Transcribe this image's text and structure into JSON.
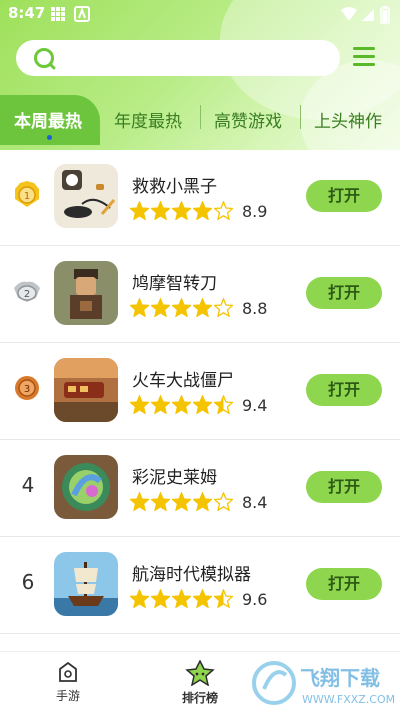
{
  "status_bar": {
    "time": "8:47"
  },
  "search": {
    "placeholder": ""
  },
  "tabs": [
    {
      "label": "本周最热",
      "active": true
    },
    {
      "label": "年度最热",
      "active": false
    },
    {
      "label": "高赞游戏",
      "active": false
    },
    {
      "label": "上头神作",
      "active": false
    }
  ],
  "ranking": [
    {
      "rank": "1",
      "medal": "gold",
      "name": "救救小黑子",
      "rating": 4,
      "score": "8.9",
      "button": "打开"
    },
    {
      "rank": "2",
      "medal": "silver",
      "name": "鸠摩智转刀",
      "rating": 4,
      "score": "8.8",
      "button": "打开"
    },
    {
      "rank": "3",
      "medal": "bronze",
      "name": "火车大战僵尸",
      "rating": 4.5,
      "score": "9.4",
      "button": "打开"
    },
    {
      "rank": "4",
      "medal": "",
      "name": "彩泥史莱姆",
      "rating": 4,
      "score": "8.4",
      "button": "打开"
    },
    {
      "rank": "6",
      "medal": "",
      "name": "航海时代模拟器",
      "rating": 4.5,
      "score": "9.6",
      "button": "打开"
    }
  ],
  "bottom_nav": [
    {
      "label": "手游",
      "icon": "home-icon"
    },
    {
      "label": "排行榜",
      "icon": "star-face-icon"
    }
  ],
  "watermark": {
    "text": "飞翔下载",
    "url": "WWW.FXXZ.COM"
  },
  "colors": {
    "accent": "#8fd64f",
    "tab_active": "#6cc53c",
    "star": "#f5c400"
  }
}
